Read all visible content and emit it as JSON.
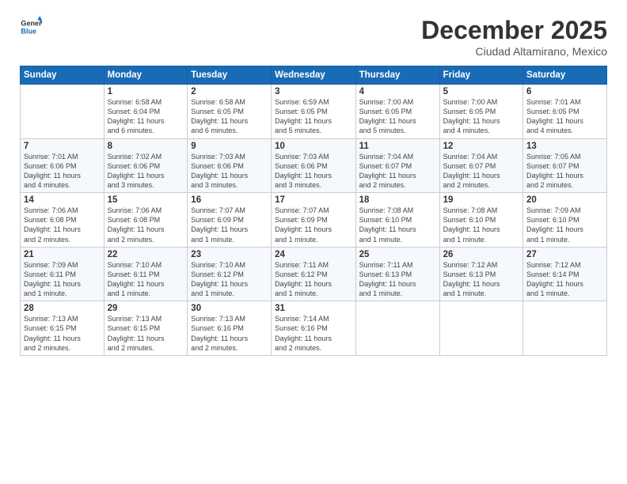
{
  "logo": {
    "line1": "General",
    "line2": "Blue"
  },
  "title": "December 2025",
  "subtitle": "Ciudad Altamirano, Mexico",
  "weekdays": [
    "Sunday",
    "Monday",
    "Tuesday",
    "Wednesday",
    "Thursday",
    "Friday",
    "Saturday"
  ],
  "weeks": [
    [
      {
        "day": "",
        "info": ""
      },
      {
        "day": "1",
        "info": "Sunrise: 6:58 AM\nSunset: 6:04 PM\nDaylight: 11 hours\nand 6 minutes."
      },
      {
        "day": "2",
        "info": "Sunrise: 6:58 AM\nSunset: 6:05 PM\nDaylight: 11 hours\nand 6 minutes."
      },
      {
        "day": "3",
        "info": "Sunrise: 6:59 AM\nSunset: 6:05 PM\nDaylight: 11 hours\nand 5 minutes."
      },
      {
        "day": "4",
        "info": "Sunrise: 7:00 AM\nSunset: 6:05 PM\nDaylight: 11 hours\nand 5 minutes."
      },
      {
        "day": "5",
        "info": "Sunrise: 7:00 AM\nSunset: 6:05 PM\nDaylight: 11 hours\nand 4 minutes."
      },
      {
        "day": "6",
        "info": "Sunrise: 7:01 AM\nSunset: 6:05 PM\nDaylight: 11 hours\nand 4 minutes."
      }
    ],
    [
      {
        "day": "7",
        "info": "Sunrise: 7:01 AM\nSunset: 6:06 PM\nDaylight: 11 hours\nand 4 minutes."
      },
      {
        "day": "8",
        "info": "Sunrise: 7:02 AM\nSunset: 6:06 PM\nDaylight: 11 hours\nand 3 minutes."
      },
      {
        "day": "9",
        "info": "Sunrise: 7:03 AM\nSunset: 6:06 PM\nDaylight: 11 hours\nand 3 minutes."
      },
      {
        "day": "10",
        "info": "Sunrise: 7:03 AM\nSunset: 6:06 PM\nDaylight: 11 hours\nand 3 minutes."
      },
      {
        "day": "11",
        "info": "Sunrise: 7:04 AM\nSunset: 6:07 PM\nDaylight: 11 hours\nand 2 minutes."
      },
      {
        "day": "12",
        "info": "Sunrise: 7:04 AM\nSunset: 6:07 PM\nDaylight: 11 hours\nand 2 minutes."
      },
      {
        "day": "13",
        "info": "Sunrise: 7:05 AM\nSunset: 6:07 PM\nDaylight: 11 hours\nand 2 minutes."
      }
    ],
    [
      {
        "day": "14",
        "info": "Sunrise: 7:06 AM\nSunset: 6:08 PM\nDaylight: 11 hours\nand 2 minutes."
      },
      {
        "day": "15",
        "info": "Sunrise: 7:06 AM\nSunset: 6:08 PM\nDaylight: 11 hours\nand 2 minutes."
      },
      {
        "day": "16",
        "info": "Sunrise: 7:07 AM\nSunset: 6:09 PM\nDaylight: 11 hours\nand 1 minute."
      },
      {
        "day": "17",
        "info": "Sunrise: 7:07 AM\nSunset: 6:09 PM\nDaylight: 11 hours\nand 1 minute."
      },
      {
        "day": "18",
        "info": "Sunrise: 7:08 AM\nSunset: 6:10 PM\nDaylight: 11 hours\nand 1 minute."
      },
      {
        "day": "19",
        "info": "Sunrise: 7:08 AM\nSunset: 6:10 PM\nDaylight: 11 hours\nand 1 minute."
      },
      {
        "day": "20",
        "info": "Sunrise: 7:09 AM\nSunset: 6:10 PM\nDaylight: 11 hours\nand 1 minute."
      }
    ],
    [
      {
        "day": "21",
        "info": "Sunrise: 7:09 AM\nSunset: 6:11 PM\nDaylight: 11 hours\nand 1 minute."
      },
      {
        "day": "22",
        "info": "Sunrise: 7:10 AM\nSunset: 6:11 PM\nDaylight: 11 hours\nand 1 minute."
      },
      {
        "day": "23",
        "info": "Sunrise: 7:10 AM\nSunset: 6:12 PM\nDaylight: 11 hours\nand 1 minute."
      },
      {
        "day": "24",
        "info": "Sunrise: 7:11 AM\nSunset: 6:12 PM\nDaylight: 11 hours\nand 1 minute."
      },
      {
        "day": "25",
        "info": "Sunrise: 7:11 AM\nSunset: 6:13 PM\nDaylight: 11 hours\nand 1 minute."
      },
      {
        "day": "26",
        "info": "Sunrise: 7:12 AM\nSunset: 6:13 PM\nDaylight: 11 hours\nand 1 minute."
      },
      {
        "day": "27",
        "info": "Sunrise: 7:12 AM\nSunset: 6:14 PM\nDaylight: 11 hours\nand 1 minute."
      }
    ],
    [
      {
        "day": "28",
        "info": "Sunrise: 7:13 AM\nSunset: 6:15 PM\nDaylight: 11 hours\nand 2 minutes."
      },
      {
        "day": "29",
        "info": "Sunrise: 7:13 AM\nSunset: 6:15 PM\nDaylight: 11 hours\nand 2 minutes."
      },
      {
        "day": "30",
        "info": "Sunrise: 7:13 AM\nSunset: 6:16 PM\nDaylight: 11 hours\nand 2 minutes."
      },
      {
        "day": "31",
        "info": "Sunrise: 7:14 AM\nSunset: 6:16 PM\nDaylight: 11 hours\nand 2 minutes."
      },
      {
        "day": "",
        "info": ""
      },
      {
        "day": "",
        "info": ""
      },
      {
        "day": "",
        "info": ""
      }
    ]
  ]
}
